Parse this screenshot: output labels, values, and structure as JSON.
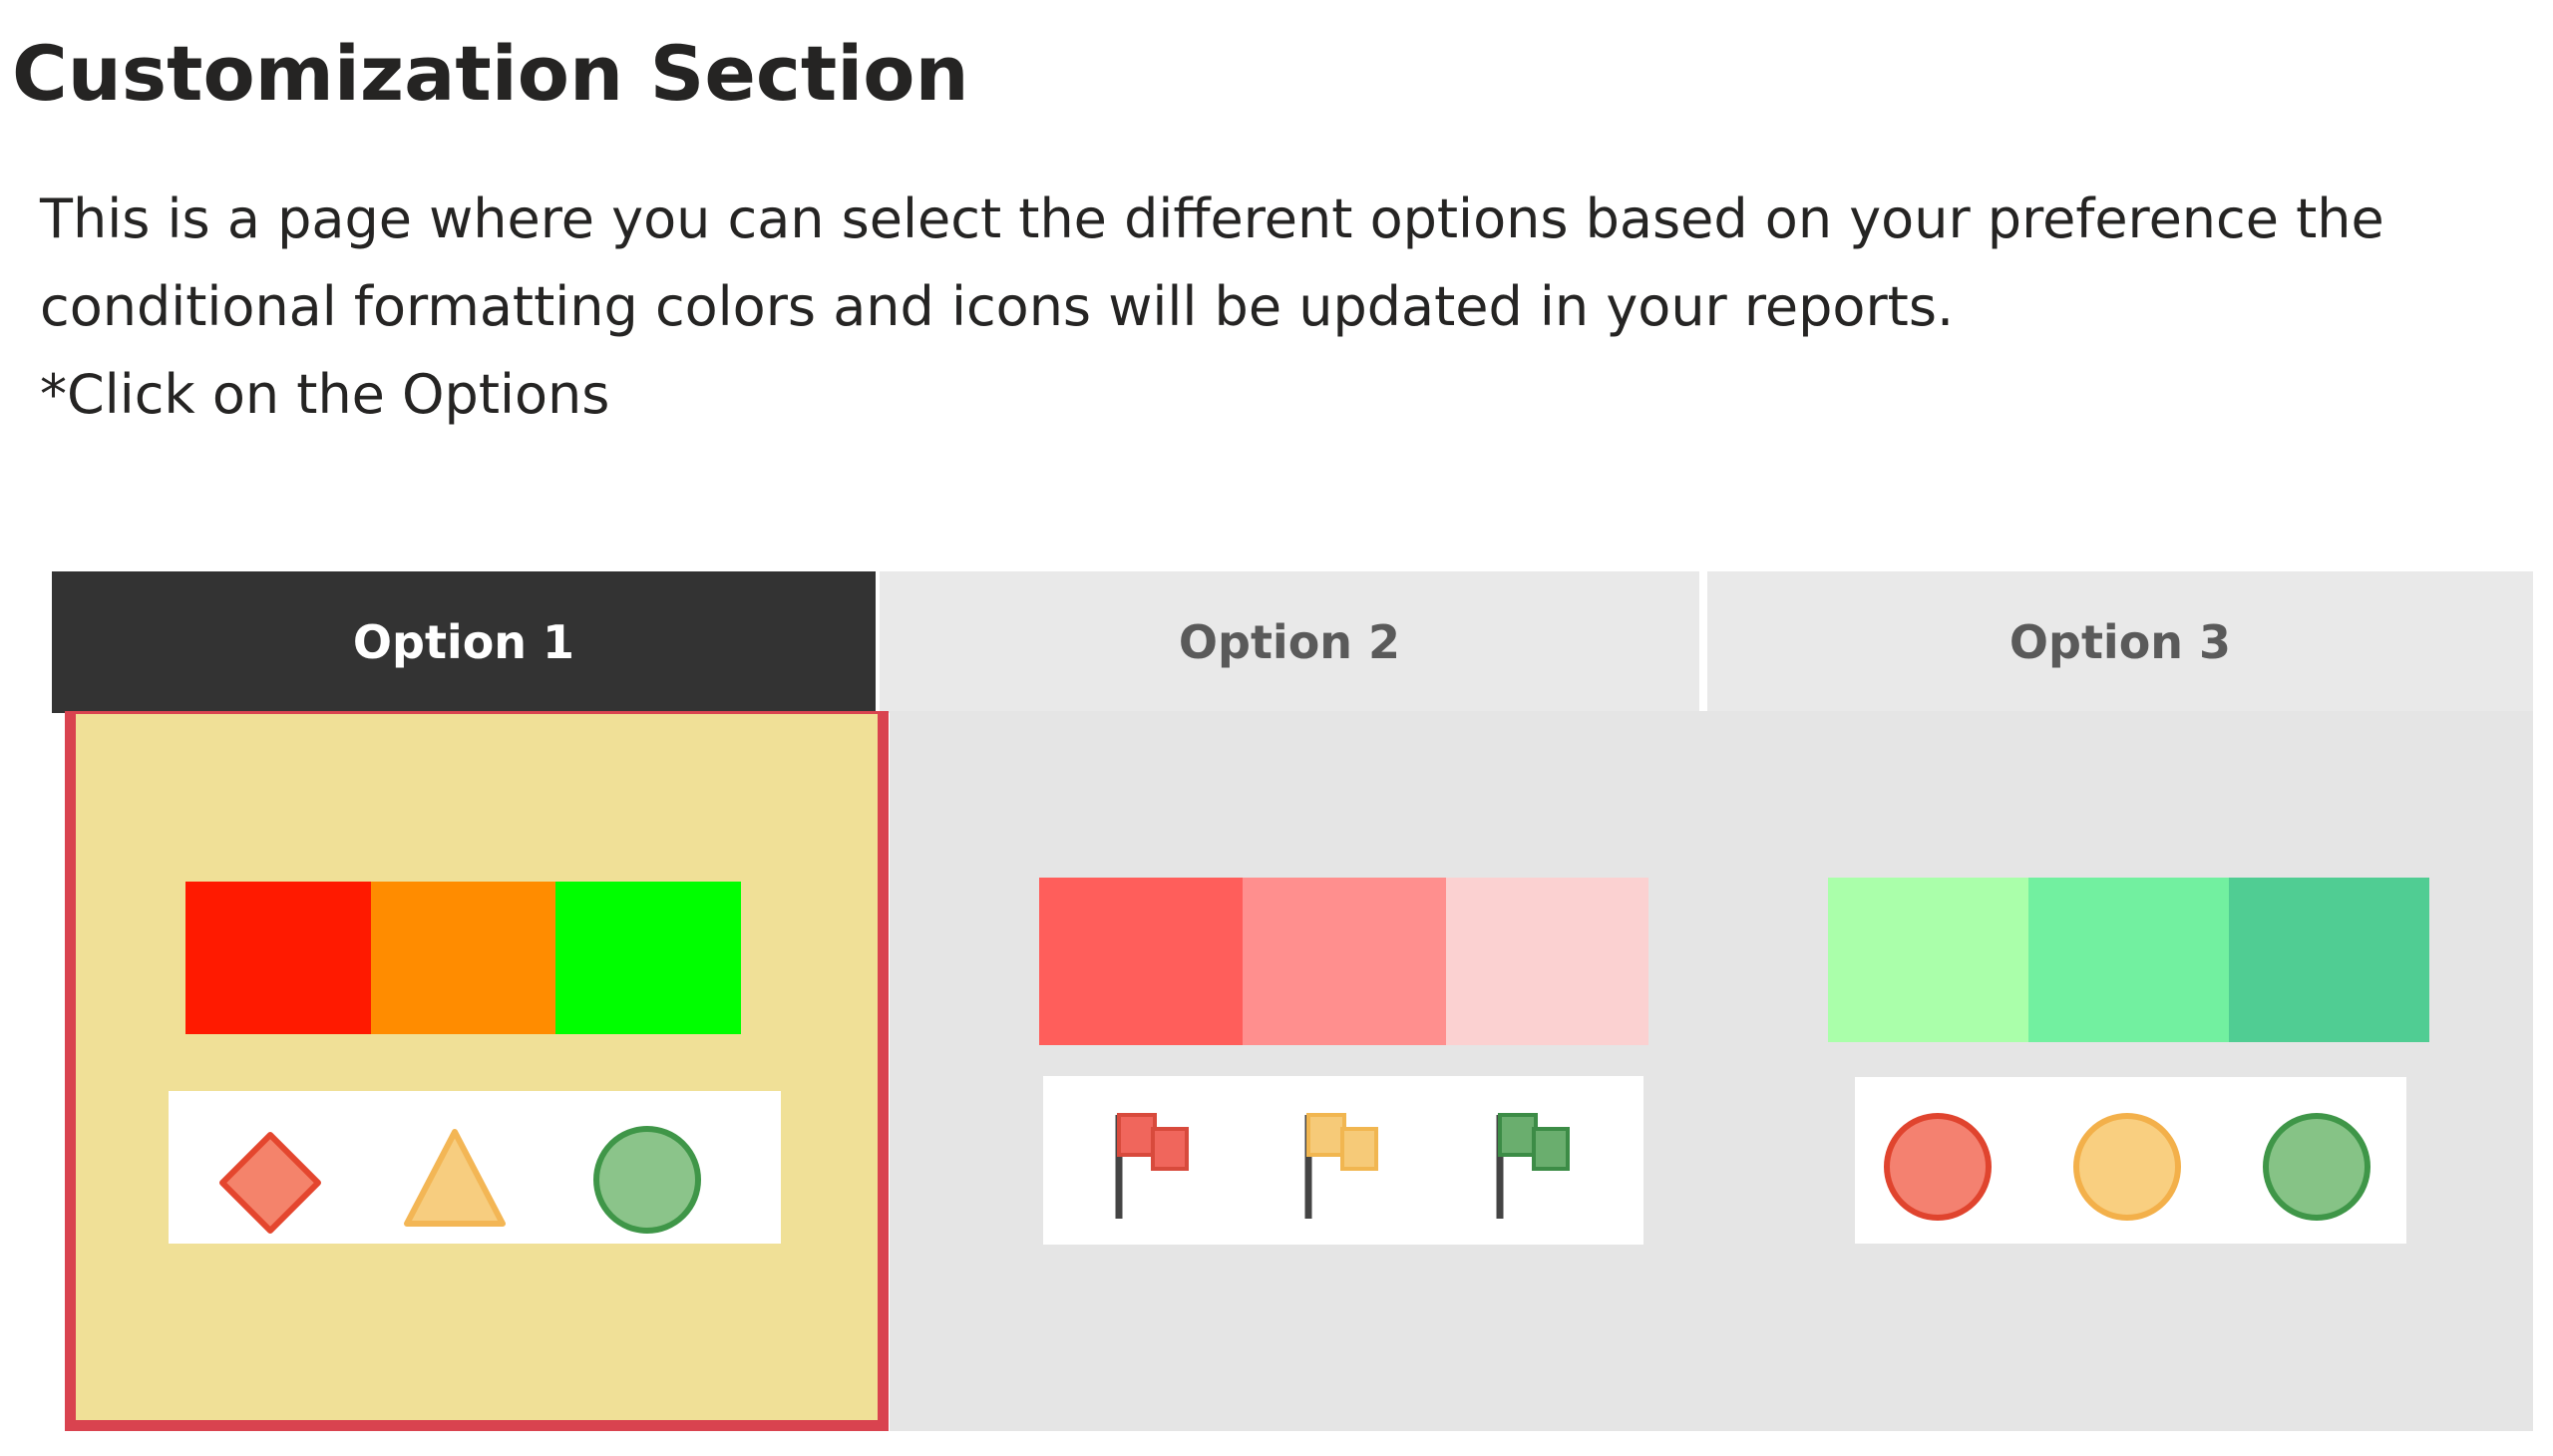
{
  "page": {
    "title": "Customization Section",
    "description_lines": [
      "This is a page where you can select the different options based on your preference the",
      "conditional formatting colors and icons will be updated in your reports.",
      "*Click on the Options"
    ]
  },
  "tabs": [
    {
      "label": "Option 1",
      "selected": true
    },
    {
      "label": "Option 2",
      "selected": false
    },
    {
      "label": "Option 3",
      "selected": false
    }
  ],
  "options": [
    {
      "colors": [
        "#ff1a00",
        "#ff8c00",
        "#00ff00"
      ],
      "icons": [
        "diamond-icon",
        "triangle-icon",
        "circle-icon"
      ],
      "icon_colors": [
        "#f4836b",
        "#f7cd7f",
        "#8bc48a"
      ]
    },
    {
      "colors": [
        "#ff5e5b",
        "#ff8f8e",
        "#fbd1d1"
      ],
      "icons": [
        "red-flag-icon",
        "yellow-flag-icon",
        "green-flag-icon"
      ],
      "icon_colors": [
        "#f0665c",
        "#f6ca78",
        "#6aae6e"
      ]
    },
    {
      "colors": [
        "#aaffaa",
        "#72f0a0",
        "#50cd93"
      ],
      "icons": [
        "red-circle-icon",
        "yellow-circle-icon",
        "green-circle-icon"
      ],
      "icon_colors": [
        "#f48170",
        "#f9cf80",
        "#86c386"
      ]
    }
  ]
}
